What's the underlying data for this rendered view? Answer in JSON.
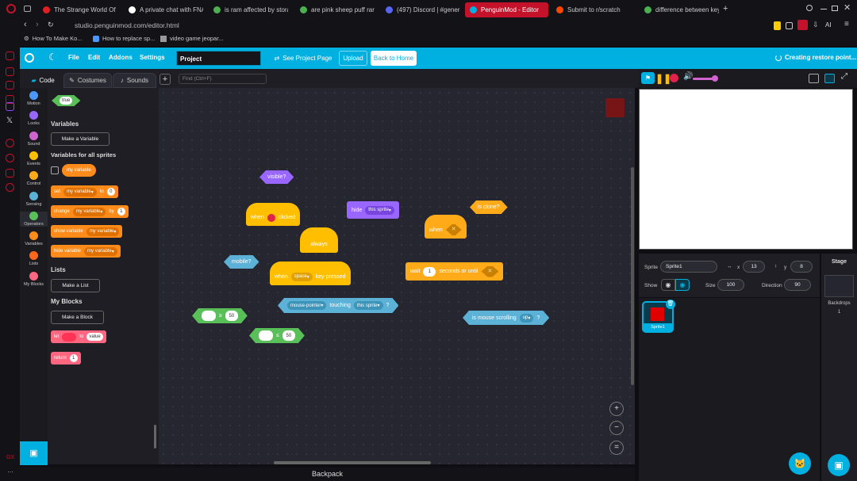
{
  "browser": {
    "tabs": [
      {
        "label": "The Strange World Of Chr",
        "color": "#e02020",
        "active": false
      },
      {
        "label": "A private chat with FNATI",
        "color": "#ffffff",
        "active": false
      },
      {
        "label": "is ram affected by storage",
        "color": "#4caf50",
        "active": false
      },
      {
        "label": "are pink sheep puff rare?",
        "color": "#4caf50",
        "active": false
      },
      {
        "label": "(497) Discord | #general |",
        "color": "#5865f2",
        "active": false
      },
      {
        "label": "PenguinMod - Editor",
        "color": "#00b0e0",
        "active": true
      },
      {
        "label": "Submit to r/scratch",
        "color": "#ff4500",
        "active": false
      },
      {
        "label": "difference between key p",
        "color": "#4caf50",
        "active": false
      }
    ],
    "new_tab": "+",
    "url": "studio.penguinmod.com/editor.html",
    "bookmarks": [
      "How To Make Ko...",
      "How to replace sp...",
      "video game jeopar..."
    ],
    "ai_label": "AI"
  },
  "menu": {
    "file": "File",
    "edit": "Edit",
    "addons": "Addons",
    "settings": "Settings",
    "project_title": "Project",
    "see_project_page": "See Project Page",
    "upload": "Upload",
    "back_home": "Back to Home",
    "restore_status": "Creating restore point..."
  },
  "tabs": {
    "code": "Code",
    "costumes": "Costumes",
    "sounds": "Sounds",
    "find_placeholder": "Find (Ctrl+F)"
  },
  "categories": [
    {
      "label": "Motion",
      "color": "#4c97ff"
    },
    {
      "label": "Looks",
      "color": "#9966ff"
    },
    {
      "label": "Sound",
      "color": "#cf63cf"
    },
    {
      "label": "Events",
      "color": "#ffbf00"
    },
    {
      "label": "Control",
      "color": "#ffab19"
    },
    {
      "label": "Sensing",
      "color": "#5cb1d6"
    },
    {
      "label": "Operators",
      "color": "#59c059"
    },
    {
      "label": "Variables",
      "color": "#ff8c1a"
    },
    {
      "label": "Lists",
      "color": "#ff661a"
    },
    {
      "label": "My Blocks",
      "color": "#ff6680"
    }
  ],
  "palette": {
    "true_block": "true",
    "variables_heading": "Variables",
    "make_variable": "Make a Variable",
    "vars_all_sprites": "Variables for all sprites",
    "my_variable": "my variable",
    "set": "set",
    "to": "to",
    "set_val": "0",
    "change": "change",
    "by": "by",
    "change_val": "1",
    "show_variable": "show variable",
    "hide_variable": "hide variable",
    "lists_heading": "Lists",
    "make_list": "Make a List",
    "myblocks_heading": "My Blocks",
    "make_block": "Make a Block",
    "let": "let",
    "value": "value",
    "return": "return",
    "return_val": "1"
  },
  "workspace": {
    "visible": "visible?",
    "when_clicked_a": "when",
    "when_clicked_b": "clicked",
    "hide": "hide",
    "this_sprite": "this sprite",
    "is_clone": "is clone?",
    "always": "always",
    "when": "when",
    "mobile": "mobile?",
    "when_key_a": "when",
    "key_space": "space",
    "key_pressed": "key pressed",
    "wait": "wait",
    "wait_val": "1",
    "seconds_until": "seconds or until",
    "mouse_pointer": "mouse-pointer",
    "touching": "touching",
    "touching_target": "this sprite",
    "q": "?",
    "ge_op": "≥",
    "ge_val": "50",
    "le_op": "≤",
    "le_val": "50",
    "is_scrolling": "is mouse scrolling",
    "up": "up"
  },
  "backpack": "Backpack",
  "sprite": {
    "sprite_label": "Sprite",
    "name": "Sprite1",
    "x_label": "x",
    "x": "13",
    "y_label": "y",
    "y": "8",
    "show_label": "Show",
    "size_label": "Size",
    "size": "100",
    "direction_label": "Direction",
    "direction": "90",
    "thumb_name": "Sprite1"
  },
  "stage_panel": {
    "title": "Stage",
    "backdrops_label": "Backdrops",
    "backdrops_count": "1"
  },
  "colors": {
    "accent": "#00b0e0",
    "opera_red": "#c4122b"
  }
}
